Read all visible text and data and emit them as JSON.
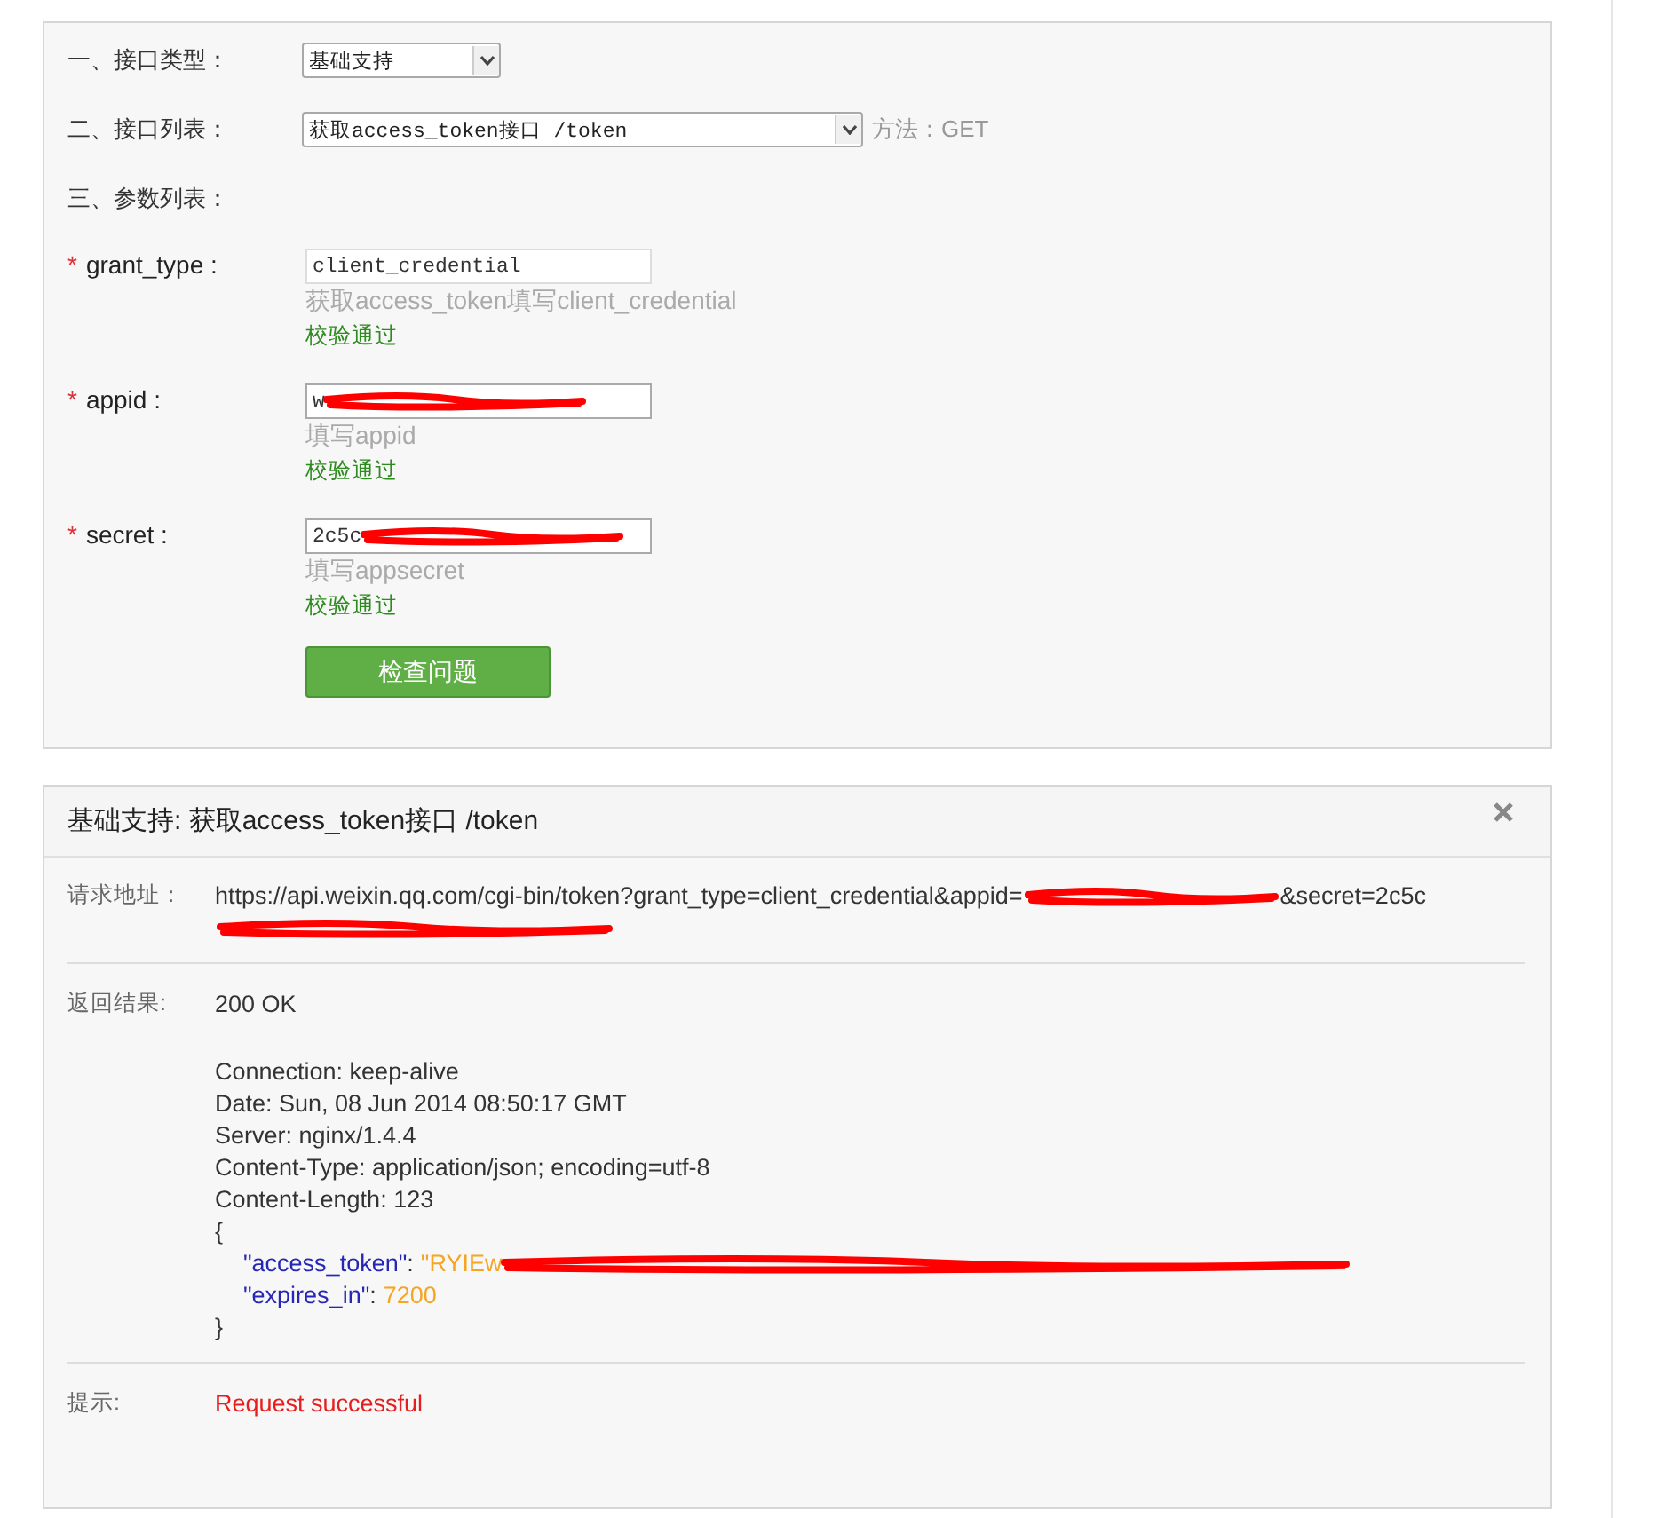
{
  "form": {
    "rows": [
      {
        "label": "一、接口类型：",
        "select": "基础支持"
      },
      {
        "label": "二、接口列表：",
        "select": "获取access_token接口 /token",
        "method": "方法：GET"
      }
    ],
    "params_heading": "三、参数列表：",
    "params": [
      {
        "mark": "*",
        "name": "grant_type :",
        "value": "client_credential",
        "redacted": false,
        "focused": false,
        "hint": "获取access_token填写client_credential",
        "status": "校验通过"
      },
      {
        "mark": "*",
        "name": "appid :",
        "value": "w",
        "redacted": true,
        "focused": true,
        "hint": "填写appid",
        "status": "校验通过"
      },
      {
        "mark": "*",
        "name": "secret :",
        "value": "2c5c",
        "redacted": true,
        "focused": true,
        "hint": "填写appsecret",
        "status": "校验通过"
      }
    ],
    "submit": "检查问题"
  },
  "result": {
    "title": "基础支持: 获取access_token接口 /token",
    "request": {
      "label": "请求地址：",
      "before": "https://api.weixin.qq.com/cgi-bin/token?grant_type=client_credential&appid=",
      "after": "&secret=2c5c"
    },
    "response": {
      "label": "返回结果:",
      "status": "200 OK",
      "headers": [
        "Connection: keep-alive",
        "Date: Sun, 08 Jun 2014 08:50:17 GMT",
        "Server: nginx/1.4.4",
        "Content-Type: application/json; encoding=utf-8",
        "Content-Length: 123"
      ],
      "open": "{",
      "fields": [
        {
          "key": "\"access_token\"",
          "sep": ":",
          "value": "\"RYIEw",
          "redacted": true
        },
        {
          "key": "\"expires_in\"",
          "sep": ":",
          "value": "7200",
          "redacted": false
        }
      ],
      "close": "}"
    },
    "tip": {
      "label": "提示:",
      "message": "Request successful"
    }
  }
}
